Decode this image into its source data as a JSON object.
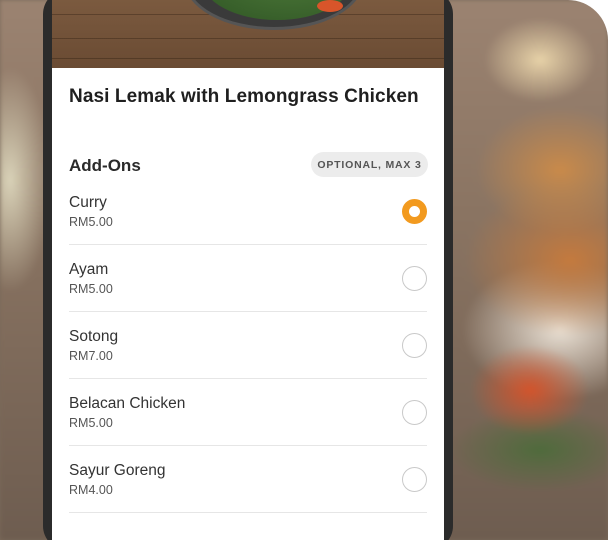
{
  "item": {
    "title": "Nasi Lemak with Lemongrass Chicken"
  },
  "addons": {
    "section_title": "Add-Ons",
    "badge": "OPTIONAL, MAX 3",
    "options": [
      {
        "name": "Curry",
        "price": "RM5.00",
        "selected": true
      },
      {
        "name": "Ayam",
        "price": "RM5.00",
        "selected": false
      },
      {
        "name": "Sotong",
        "price": "RM7.00",
        "selected": false
      },
      {
        "name": "Belacan Chicken",
        "price": "RM5.00",
        "selected": false
      },
      {
        "name": "Sayur Goreng",
        "price": "RM4.00",
        "selected": false
      }
    ]
  },
  "colors": {
    "accent": "#f29a1f",
    "radio_border": "#c9c9c9",
    "divider": "#e6e6e6"
  }
}
